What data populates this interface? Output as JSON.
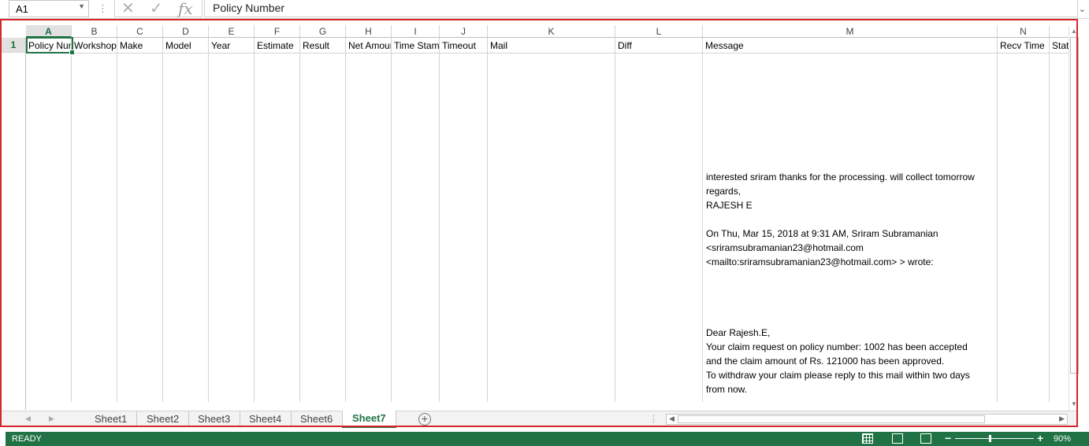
{
  "formula_bar": {
    "name_box": "A1",
    "formula": "Policy Number",
    "cancel_glyph": "✕",
    "enter_glyph": "✓",
    "fx_glyph": "fx"
  },
  "columns": [
    {
      "letter": "A",
      "header": "Policy Number"
    },
    {
      "letter": "B",
      "header": "Workshop"
    },
    {
      "letter": "C",
      "header": "Make"
    },
    {
      "letter": "D",
      "header": "Model"
    },
    {
      "letter": "E",
      "header": "Year"
    },
    {
      "letter": "F",
      "header": "Estimate"
    },
    {
      "letter": "G",
      "header": "Result"
    },
    {
      "letter": "H",
      "header": "Net Amount"
    },
    {
      "letter": "I",
      "header": "Time Stamp"
    },
    {
      "letter": "J",
      "header": "Timeout"
    },
    {
      "letter": "K",
      "header": "Mail"
    },
    {
      "letter": "L",
      "header": "Diff"
    },
    {
      "letter": "M",
      "header": "Message"
    },
    {
      "letter": "N",
      "header": "Recv Time"
    },
    {
      "letter": "",
      "header": "Status"
    }
  ],
  "row_number": "1",
  "message_cell": "interested sriram thanks for the processing. will collect tomorrow\nregards,\nRAJESH E\n\nOn Thu, Mar 15, 2018 at 9:31 AM, Sriram Subramanian\n<sriramsubramanian23@hotmail.com\n<mailto:sriramsubramanian23@hotmail.com> > wrote:\n\n\n\n\nDear Rajesh.E,\nYour claim request on policy number: 1002 has been accepted\nand the claim amount of Rs. 121000 has been approved.\nTo withdraw your claim please reply to this mail within two days\nfrom now.",
  "sheet_tabs": [
    "Sheet1",
    "Sheet2",
    "Sheet3",
    "Sheet4",
    "Sheet6",
    "Sheet7"
  ],
  "active_sheet": "Sheet7",
  "status": {
    "text": "READY",
    "zoom": "90%"
  },
  "colors": {
    "accent": "#217346",
    "highlight_frame": "#d6262c"
  },
  "icons": [
    "chevron-down-icon",
    "cancel-icon",
    "enter-icon",
    "function-icon",
    "add-sheet-icon",
    "normal-view-icon",
    "page-layout-icon",
    "page-break-icon"
  ]
}
